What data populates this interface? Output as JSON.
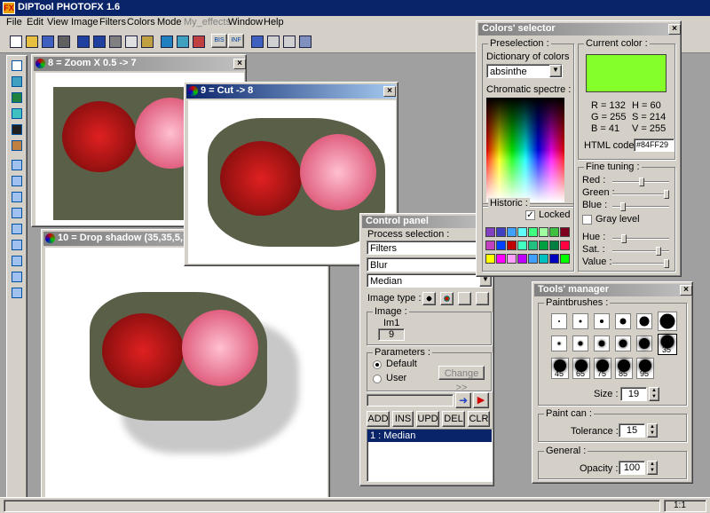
{
  "app": {
    "title": "DIPTool PHOTOFX 1.6"
  },
  "menu": [
    "File",
    "Edit",
    "View",
    "Image",
    "Filters",
    "Colors",
    "Mode",
    "My_effects",
    "Window",
    "Help"
  ],
  "toolbar": {
    "bis_label": "BIS",
    "inf_label": "INF"
  },
  "windows": {
    "zoom": {
      "title": "8 = Zoom X 0.5 -> 7"
    },
    "cut": {
      "title": "9 = Cut -> 8"
    },
    "shadow": {
      "title": "10 = Drop shadow (35,35,5,150)"
    }
  },
  "control_panel": {
    "title": "Control panel",
    "process_selection_label": "Process selection :",
    "process_1": "Filters",
    "process_2": "Blur",
    "process_3": "Median",
    "image_type_label": "Image type :",
    "image_group_label": "Image :",
    "image_name": "Im1",
    "image_number": "9",
    "parameters_label": "Parameters :",
    "default_label": "Default",
    "user_label": "User",
    "change_label": "Change >>",
    "add_label": "ADD",
    "ins_label": "INS",
    "upd_label": "UPD",
    "del_label": "DEL",
    "clr_label": "CLR",
    "list_item": "1 : Median"
  },
  "colors_selector": {
    "title": "Colors' selector",
    "preselection_label": "Preselection :",
    "dictionary_label": "Dictionary of colors :",
    "dictionary_value": "absinthe",
    "chromatic_label": "Chromatic spectre :",
    "historic_label": "Historic :",
    "locked_label": "Locked",
    "current_color_label": "Current color :",
    "current_color": "#84FF29",
    "r_text": "R = 132",
    "g_text": "G = 255",
    "b_text": "B = 41",
    "h_text": "H = 60",
    "s_text": "S = 214",
    "v_text": "V = 255",
    "html_code_label": "HTML code :",
    "html_code_value": "#84FF29",
    "fine_tuning_label": "Fine tuning :",
    "red_label": "Red :",
    "green_label": "Green :",
    "blue_label": "Blue :",
    "gray_label": "Gray level",
    "hue_label": "Hue :",
    "sat_label": "Sat. :",
    "value_label": "Value :",
    "sliders": {
      "red": 0.52,
      "green": 1.0,
      "blue": 0.16,
      "hue": 0.17,
      "sat": 0.84,
      "value": 1.0
    },
    "swatches": [
      "#8040c0",
      "#4040c0",
      "#40a0ff",
      "#60ffff",
      "#40ff80",
      "#a0ffa0",
      "#40c040",
      "#800020",
      "#c040c0",
      "#0040ff",
      "#c00000",
      "#40ffc0",
      "#20c080",
      "#00a040",
      "#008040",
      "#ff0040",
      "#ffff00",
      "#ff00ff",
      "#ffa0ff",
      "#c000ff",
      "#40a0ff",
      "#00c0c0",
      "#0000c0",
      "#00ff00"
    ]
  },
  "tools_manager": {
    "title": "Tools' manager",
    "paintbrushes_label": "Paintbrushes :",
    "brush_35": "35",
    "brush_45": "45",
    "brush_65": "65",
    "brush_75": "75",
    "brush_85": "85",
    "brush_95": "95",
    "size_label": "Size :",
    "size_value": "19",
    "paint_can_label": "Paint can :",
    "tolerance_label": "Tolerance :",
    "tolerance_value": "15",
    "general_label": "General :",
    "opacity_label": "Opacity :",
    "opacity_value": "100"
  },
  "status": {
    "zoom": "1:1"
  }
}
